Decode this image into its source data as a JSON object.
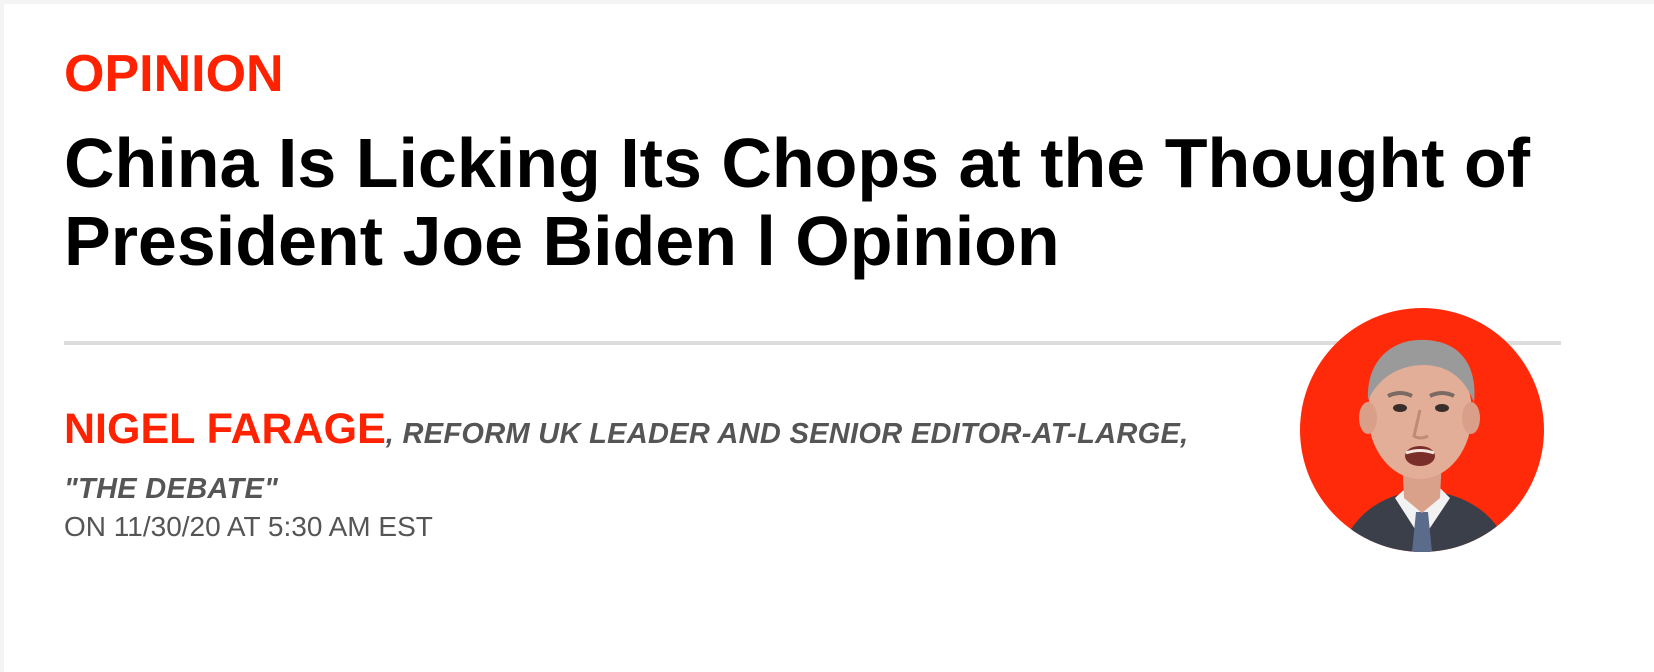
{
  "section": {
    "label": "OPINION"
  },
  "article": {
    "headline": "China Is Licking Its Chops at the Thought of President Joe Biden l Opinion"
  },
  "byline": {
    "author": "NIGEL FARAGE",
    "role": ", REFORM UK LEADER AND SENIOR EDITOR-AT-LARGE, \"THE DEBATE\"",
    "dateline": "ON 11/30/20 AT 5:30 AM EST"
  },
  "colors": {
    "accent": "#ff2200",
    "headline": "#000000",
    "meta": "#555555",
    "avatar_background": "#ff2a0a"
  }
}
